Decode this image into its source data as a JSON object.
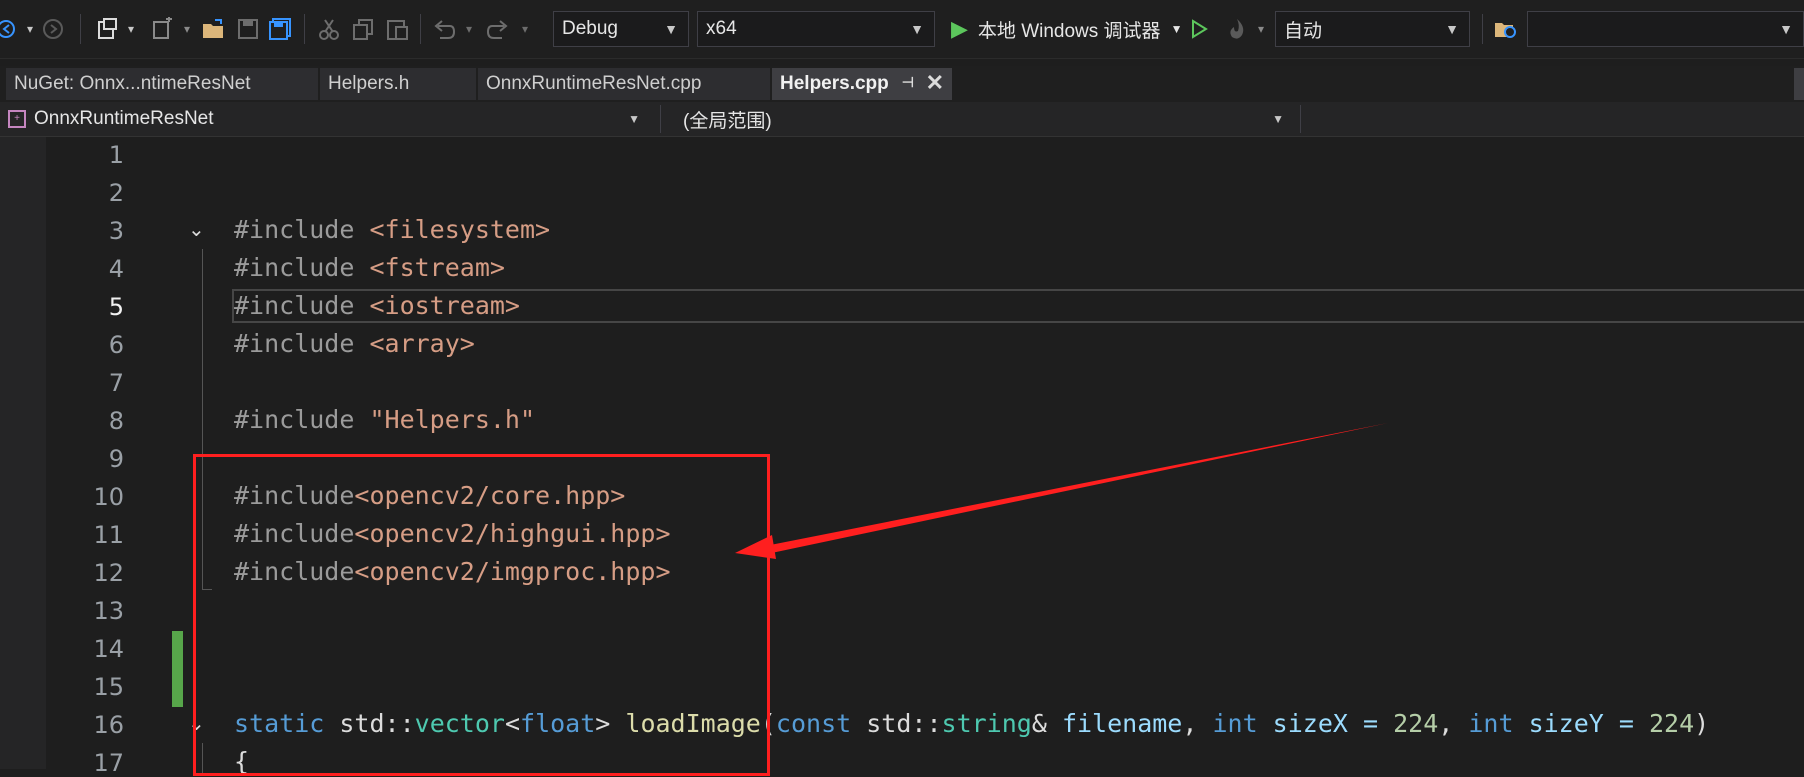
{
  "toolbar": {
    "config": "Debug",
    "platform": "x64",
    "run_label": "本地 Windows 调试器",
    "auto_label": "自动",
    "search_value": ""
  },
  "tabs": [
    {
      "label": "NuGet: Onnx...ntimeResNet"
    },
    {
      "label": "Helpers.h"
    },
    {
      "label": "OnnxRuntimeResNet.cpp"
    },
    {
      "label": "Helpers.cpp"
    }
  ],
  "navbar": {
    "project": "OnnxRuntimeResNet",
    "scope": "(全局范围)"
  },
  "editor": {
    "line_numbers": [
      "1",
      "2",
      "3",
      "4",
      "5",
      "6",
      "7",
      "8",
      "9",
      "10",
      "11",
      "12",
      "13",
      "14",
      "15",
      "16",
      "17"
    ],
    "current_line": 5,
    "lines": {
      "l3": {
        "a": "#include ",
        "b": "<filesystem>"
      },
      "l4": {
        "a": "#include ",
        "b": "<fstream>"
      },
      "l5": {
        "a": "#include ",
        "b": "<iostream>"
      },
      "l6": {
        "a": "#include ",
        "b": "<array>"
      },
      "l8": {
        "a": "#include ",
        "b": "\"Helpers.h\""
      },
      "l10": {
        "a": "#include",
        "b": "<opencv2/core.hpp>"
      },
      "l11": {
        "a": "#include",
        "b": "<opencv2/highgui.hpp>"
      },
      "l12": {
        "a": "#include",
        "b": "<opencv2/imgproc.hpp>"
      },
      "l16": {
        "static": "static",
        "std1": "std",
        "colons1": "::",
        "vector": "vector",
        "lt": "<",
        "float": "float",
        "gt": "> ",
        "fn": "loadImage",
        "paren": "(",
        "const": "const",
        "std2": " std",
        "colons2": "::",
        "string": "string",
        "amp": "& ",
        "p1": "filename",
        "comma1": ", ",
        "int1": "int",
        "p2": " sizeX = ",
        "n1": "224",
        "comma2": ", ",
        "int2": "int",
        "p3": " sizeY = ",
        "n2": "224",
        "close": ")"
      },
      "l17": {
        "a": "{"
      }
    }
  },
  "colors": {
    "annotation": "#ff1f1f",
    "change_bar": "#57a64a",
    "keyword": "#569cd6",
    "string": "#d69d85",
    "type": "#4ec9b0"
  }
}
